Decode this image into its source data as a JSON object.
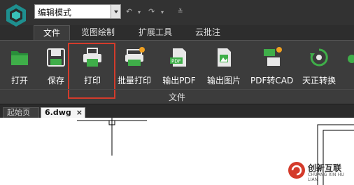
{
  "toolbar_top": {
    "mode_value": "编辑模式",
    "quick_actions": [
      "undo-icon",
      "undo-dropdown-icon",
      "redo-icon",
      "redo-dropdown-icon",
      "customize-icon"
    ]
  },
  "tabs": [
    {
      "label": "文件",
      "active": true
    },
    {
      "label": "览图绘制"
    },
    {
      "label": "扩展工具"
    },
    {
      "label": "云批注"
    }
  ],
  "ribbon": {
    "buttons": [
      {
        "label": "打开",
        "icon": "folder-open-icon"
      },
      {
        "label": "保存",
        "icon": "save-icon"
      },
      {
        "label": "打印",
        "icon": "printer-icon",
        "highlighted": true
      },
      {
        "label": "批量打印",
        "icon": "batch-print-icon",
        "vip": true
      },
      {
        "label": "输出PDF",
        "icon": "export-pdf-icon"
      },
      {
        "label": "输出图片",
        "icon": "export-image-icon"
      },
      {
        "label": "PDF转CAD",
        "icon": "pdf-to-cad-icon",
        "vip": true
      },
      {
        "label": "天正转换",
        "icon": "tangent-convert-icon"
      }
    ],
    "group_label": "文件",
    "highlight_color": "#d43b2b"
  },
  "doc_tabs": {
    "start": "起始页",
    "active": "6.dwg",
    "close": "×"
  },
  "watermark": {
    "name": "创新互联",
    "sub": "CHUANG XIN HU LIAN"
  },
  "colors": {
    "accent_green": "#3fae49",
    "vip_badge": "#f0a020"
  }
}
